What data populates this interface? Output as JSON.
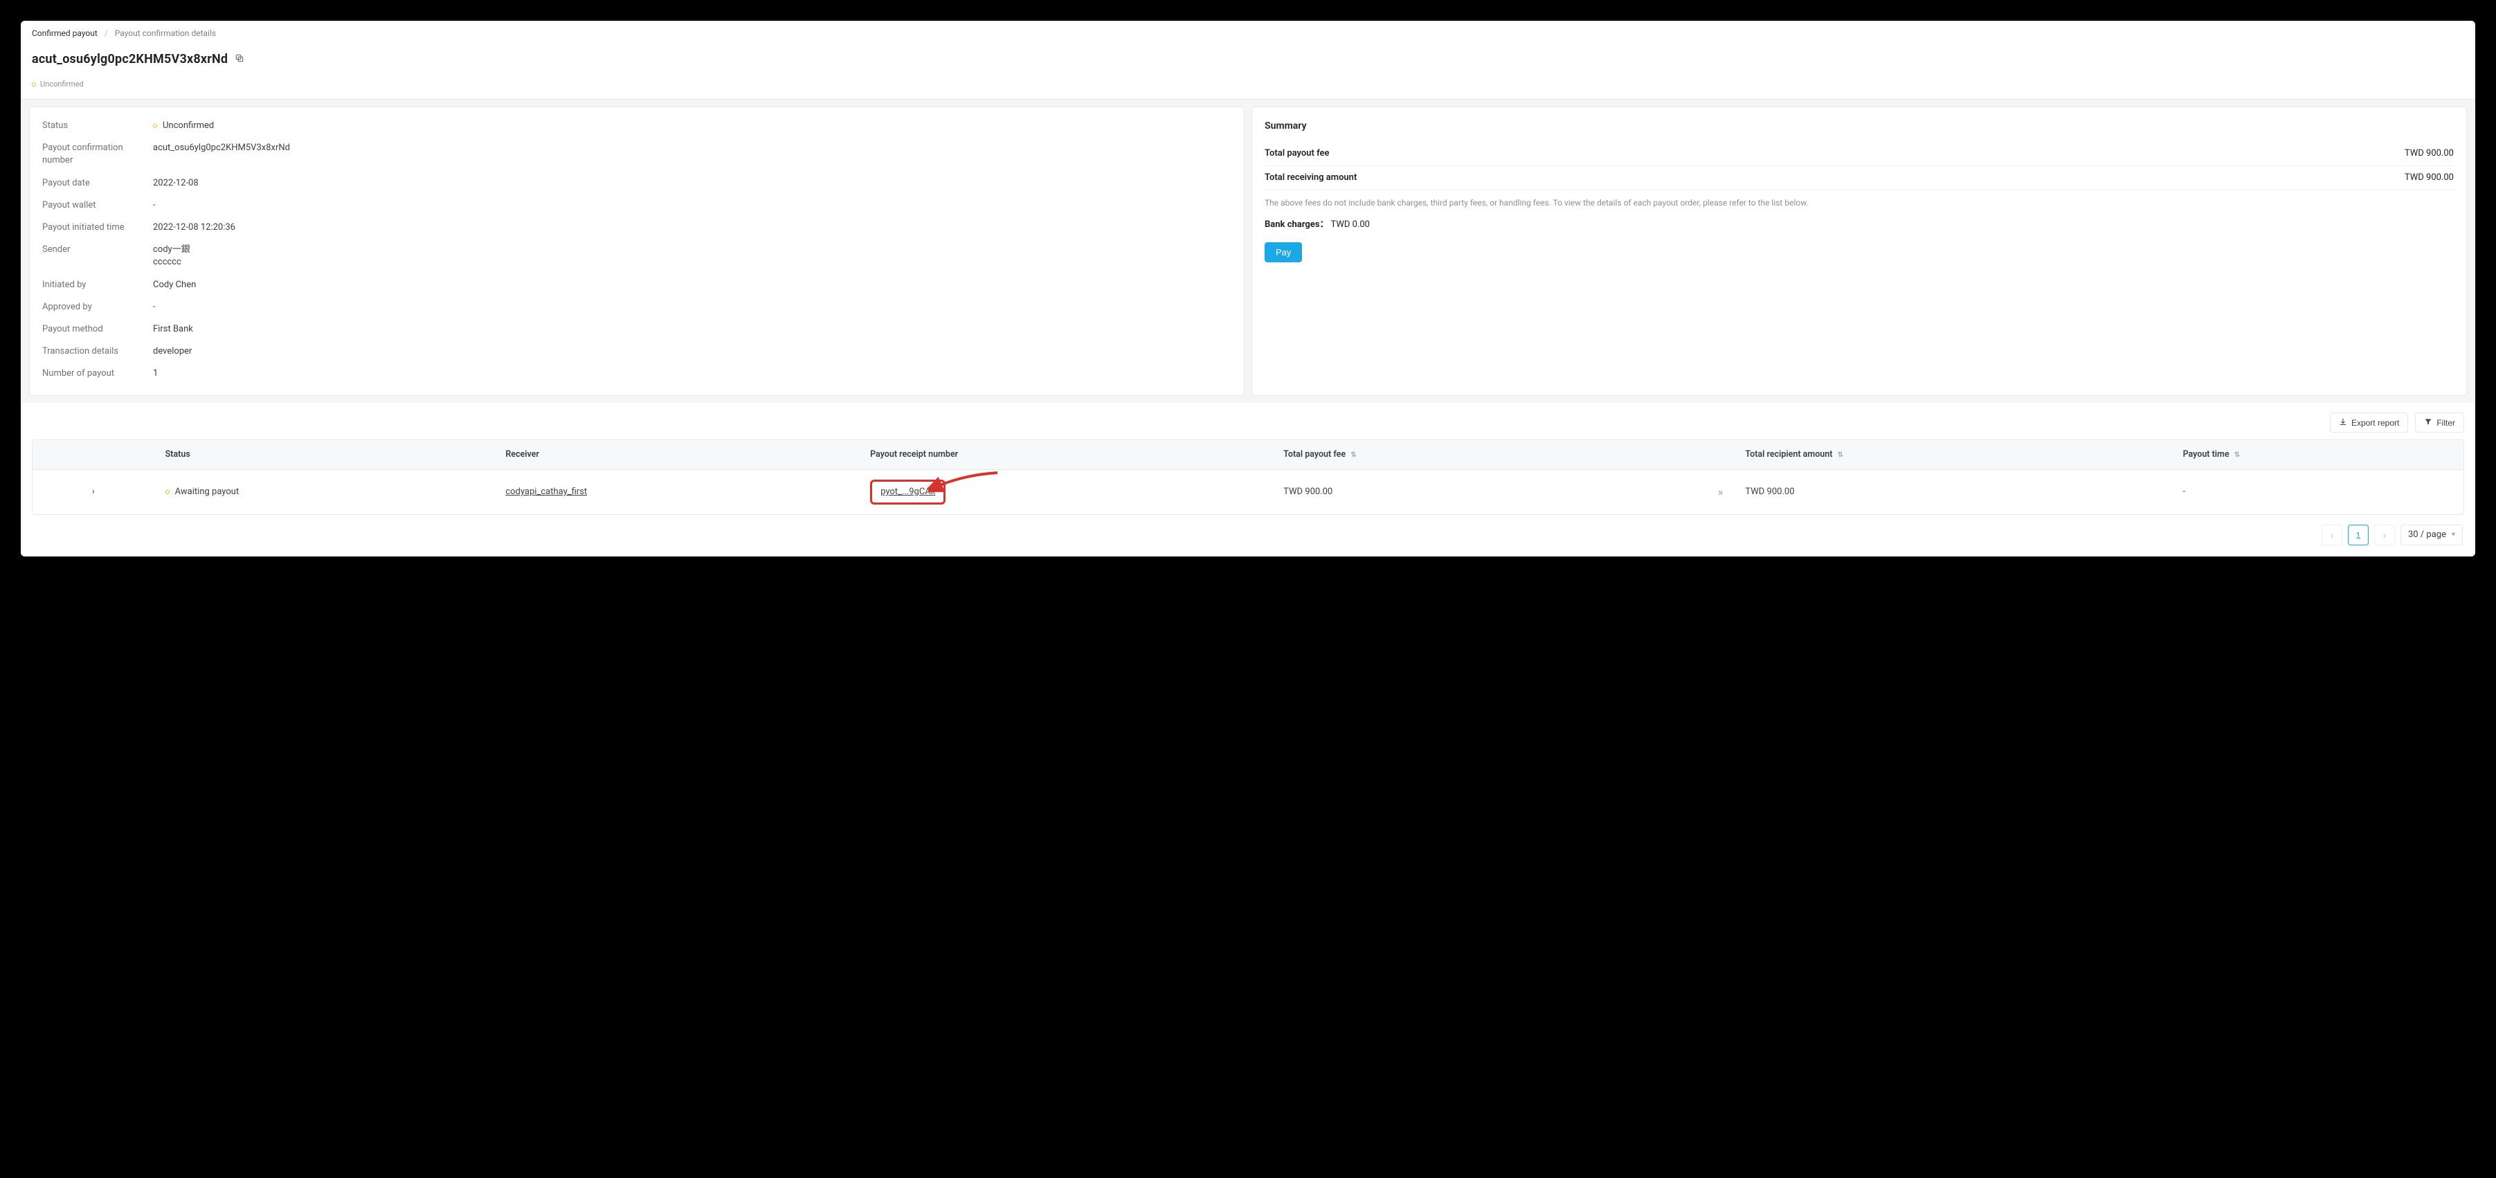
{
  "breadcrumbs": {
    "root": "Confirmed payout",
    "current": "Payout confirmation details"
  },
  "header": {
    "title": "acut_osu6ylg0pc2KHM5V3x8xrNd",
    "status_label": "Unconfirmed"
  },
  "details": {
    "status_label": "Status",
    "status_value": "Unconfirmed",
    "conf_num_label": "Payout confirmation number",
    "conf_num_value": "acut_osu6ylg0pc2KHM5V3x8xrNd",
    "date_label": "Payout date",
    "date_value": "2022-12-08",
    "wallet_label": "Payout wallet",
    "wallet_value": "-",
    "init_time_label": "Payout initiated time",
    "init_time_value": "2022-12-08 12:20:36",
    "sender_label": "Sender",
    "sender_value": "cody一銀\ncccccc",
    "initiated_by_label": "Initiated by",
    "initiated_by_value": "Cody Chen",
    "approved_by_label": "Approved by",
    "approved_by_value": "-",
    "method_label": "Payout method",
    "method_value": "First Bank",
    "txn_label": "Transaction details",
    "txn_value": "developer",
    "count_label": "Number of payout",
    "count_value": "1"
  },
  "summary": {
    "title": "Summary",
    "fee_label": "Total payout fee",
    "fee_value": "TWD 900.00",
    "recv_label": "Total receiving amount",
    "recv_value": "TWD 900.00",
    "note": "The above fees do not include bank charges, third party fees, or handling fees. To view the details of each payout order, please refer to the list below.",
    "bank_label": "Bank charges：",
    "bank_value": "TWD 0.00",
    "pay_button": "Pay"
  },
  "actions": {
    "export": "Export report",
    "filter": "Filter"
  },
  "table": {
    "headers": {
      "status": "Status",
      "receiver": "Receiver",
      "receipt": "Payout receipt number",
      "fee": "Total payout fee",
      "recipient": "Total recipient amount",
      "time": "Payout time"
    },
    "rows": [
      {
        "status": "Awaiting payout",
        "receiver": "codyapi_cathay_first",
        "receipt": "pyot_...9gCAk",
        "fee": "TWD 900.00",
        "recipient": "TWD 900.00",
        "time": "-"
      }
    ]
  },
  "pagination": {
    "current": "1",
    "per_page": "30 / page"
  },
  "icons": {
    "sort": "⇅",
    "down": "▾",
    "right": "›",
    "left": "‹",
    "more": "»"
  }
}
